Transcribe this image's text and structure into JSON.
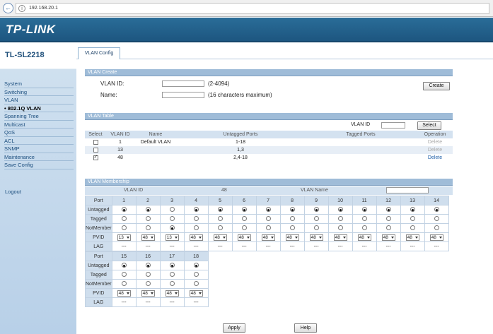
{
  "browser": {
    "url": "192.168.20.1"
  },
  "header": {
    "logo": "TP-LINK",
    "model": "TL-SL2218"
  },
  "sidebar": {
    "items": [
      {
        "label": "System",
        "active": false
      },
      {
        "label": "Switching",
        "active": false
      },
      {
        "label": "VLAN",
        "active": false
      },
      {
        "label": "• 802.1Q VLAN",
        "active": true
      },
      {
        "label": "Spanning Tree",
        "active": false
      },
      {
        "label": "Multicast",
        "active": false
      },
      {
        "label": "QoS",
        "active": false
      },
      {
        "label": "ACL",
        "active": false
      },
      {
        "label": "SNMP",
        "active": false
      },
      {
        "label": "Maintenance",
        "active": false
      },
      {
        "label": "Save Config",
        "active": false
      }
    ],
    "logout": "Logout"
  },
  "tab": {
    "label": "VLAN Config"
  },
  "vlan_create": {
    "title": "VLAN Create",
    "vlan_id_label": "VLAN ID:",
    "vlan_id_hint": "(2-4094)",
    "name_label": "Name:",
    "name_hint": "(16 characters maximum)",
    "create_button": "Create"
  },
  "vlan_table": {
    "title": "VLAN Table",
    "vlan_id_search_label": "VLAN ID",
    "select_button": "Select",
    "headers": {
      "select": "Select",
      "vlan_id": "VLAN ID",
      "name": "Name",
      "untagged": "Untagged Ports",
      "tagged": "Tagged Ports",
      "operation": "Operation"
    },
    "rows": [
      {
        "checked": false,
        "vlan_id": "1",
        "name": "Default VLAN",
        "untagged": "1-18",
        "tagged": "",
        "operation": "Delete"
      },
      {
        "checked": false,
        "vlan_id": "13",
        "name": "",
        "untagged": "1,3",
        "tagged": "",
        "operation": "Delete"
      },
      {
        "checked": true,
        "vlan_id": "48",
        "name": "",
        "untagged": "2,4-18",
        "tagged": "",
        "operation": "Delete"
      }
    ]
  },
  "membership": {
    "title": "VLAN Membership",
    "vlan_id_label": "VLAN ID",
    "vlan_id_value": "48",
    "vlan_name_label": "VLAN Name",
    "row_labels": {
      "port": "Port",
      "untagged": "Untagged",
      "tagged": "Tagged",
      "notmember": "NotMember",
      "pvid": "PVID",
      "lag": "LAG"
    },
    "ports": [
      {
        "port": "1",
        "mode": "untagged",
        "pvid": "13",
        "lag": "---"
      },
      {
        "port": "2",
        "mode": "untagged",
        "pvid": "48",
        "lag": "---"
      },
      {
        "port": "3",
        "mode": "notmember",
        "pvid": "13",
        "lag": "---"
      },
      {
        "port": "4",
        "mode": "untagged",
        "pvid": "48",
        "lag": "---"
      },
      {
        "port": "5",
        "mode": "untagged",
        "pvid": "48",
        "lag": "---"
      },
      {
        "port": "6",
        "mode": "untagged",
        "pvid": "48",
        "lag": "---"
      },
      {
        "port": "7",
        "mode": "untagged",
        "pvid": "48",
        "lag": "---"
      },
      {
        "port": "8",
        "mode": "untagged",
        "pvid": "48",
        "lag": "---"
      },
      {
        "port": "9",
        "mode": "untagged",
        "pvid": "48",
        "lag": "---"
      },
      {
        "port": "10",
        "mode": "untagged",
        "pvid": "48",
        "lag": "---"
      },
      {
        "port": "11",
        "mode": "untagged",
        "pvid": "48",
        "lag": "---"
      },
      {
        "port": "12",
        "mode": "untagged",
        "pvid": "48",
        "lag": "---"
      },
      {
        "port": "13",
        "mode": "untagged",
        "pvid": "48",
        "lag": "---"
      },
      {
        "port": "14",
        "mode": "untagged",
        "pvid": "48",
        "lag": "---"
      },
      {
        "port": "15",
        "mode": "untagged",
        "pvid": "48",
        "lag": "---"
      },
      {
        "port": "16",
        "mode": "untagged",
        "pvid": "48",
        "lag": "---"
      },
      {
        "port": "17",
        "mode": "untagged",
        "pvid": "48",
        "lag": "---"
      },
      {
        "port": "18",
        "mode": "untagged",
        "pvid": "48",
        "lag": "---"
      }
    ]
  },
  "footer": {
    "apply_button": "Apply",
    "help_button": "Help"
  }
}
